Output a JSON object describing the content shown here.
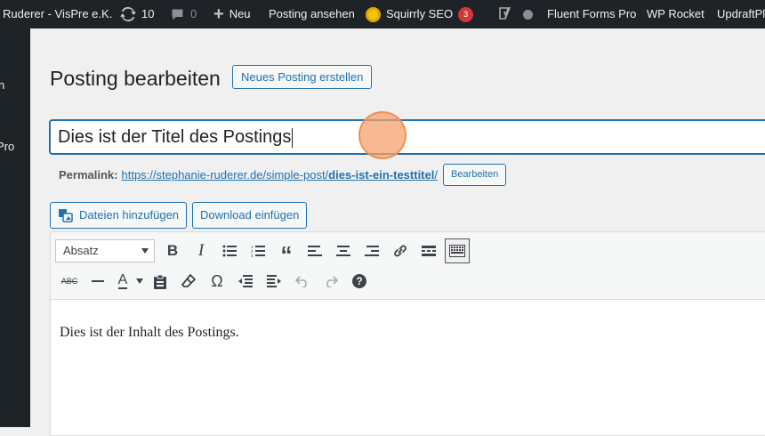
{
  "adminbar": {
    "site_name": "Ruderer - VisPre e.K.",
    "updates_count": "10",
    "comments_count": "0",
    "new_label": "Neu",
    "view_post_label": "Posting ansehen",
    "squirrly_label": "Squirrly SEO",
    "squirrly_badge": "3",
    "fluent_forms_label": "Fluent Forms Pro",
    "wp_rocket_label": "WP Rocket",
    "updraft_label": "UpdraftPl"
  },
  "sidebar": {
    "fragment_1": "n",
    "fragment_2": "Pro"
  },
  "page": {
    "title": "Posting bearbeiten",
    "new_post_button": "Neues Posting erstellen"
  },
  "post": {
    "title": "Dies ist der Titel des Postings",
    "permalink_label": "Permalink:",
    "permalink_base": "https://stephanie-ruderer.de/simple-post/",
    "permalink_slug": "dies-ist-ein-testtitel",
    "permalink_trailing": "/",
    "edit_permalink_button": "Bearbeiten",
    "content": "Dies ist der Inhalt des Postings."
  },
  "media": {
    "add_media_label": "Dateien hinzufügen",
    "add_download_label": "Download einfügen"
  },
  "toolbar": {
    "format_selected": "Absatz"
  },
  "colors": {
    "adminbar_bg": "#1d2327",
    "accent": "#2271b1",
    "badge_red": "#d63638",
    "cursor_highlight": "#f6a16e"
  }
}
